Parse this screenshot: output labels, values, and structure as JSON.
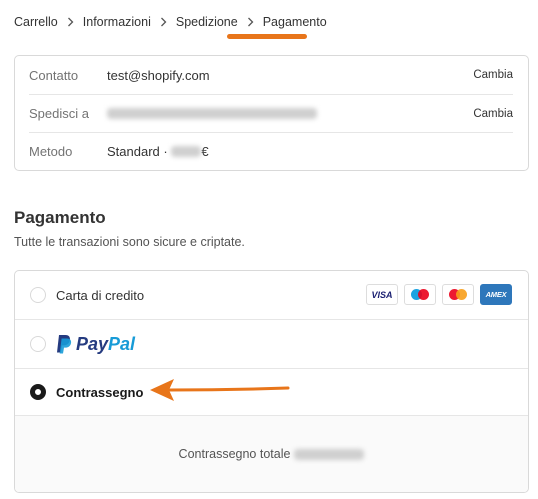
{
  "breadcrumb": {
    "items": [
      "Carrello",
      "Informazioni",
      "Spedizione",
      "Pagamento"
    ],
    "current_index": 3
  },
  "review": {
    "contact": {
      "label": "Contatto",
      "value": "test@shopify.com",
      "action": "Cambia"
    },
    "ship_to": {
      "label": "Spedisci a",
      "action": "Cambia"
    },
    "method": {
      "label": "Metodo",
      "value_prefix": "Standard · ",
      "currency": "€"
    }
  },
  "payment": {
    "title": "Pagamento",
    "subtitle": "Tutte le transazioni sono sicure e criptate.",
    "options": {
      "credit_card": {
        "label": "Carta di credito",
        "selected": false
      },
      "paypal": {
        "selected": false
      },
      "cod": {
        "label": "Contrassegno",
        "selected": true
      }
    },
    "card_brands": [
      "VISA",
      "Maestro",
      "Mastercard",
      "AMEX"
    ],
    "paypal_logo": {
      "part1": "Pay",
      "part2": "Pal"
    },
    "cod_total_label": "Contrassegno totale"
  },
  "colors": {
    "annotation": "#e8751a",
    "paypal_dark": "#253b80",
    "paypal_light": "#179bd7",
    "amex": "#2e77bb",
    "visa": "#1a1f71"
  },
  "icons": {
    "breadcrumb_separator": "chevron-right-icon",
    "annotation": "arrow-left-icon"
  }
}
